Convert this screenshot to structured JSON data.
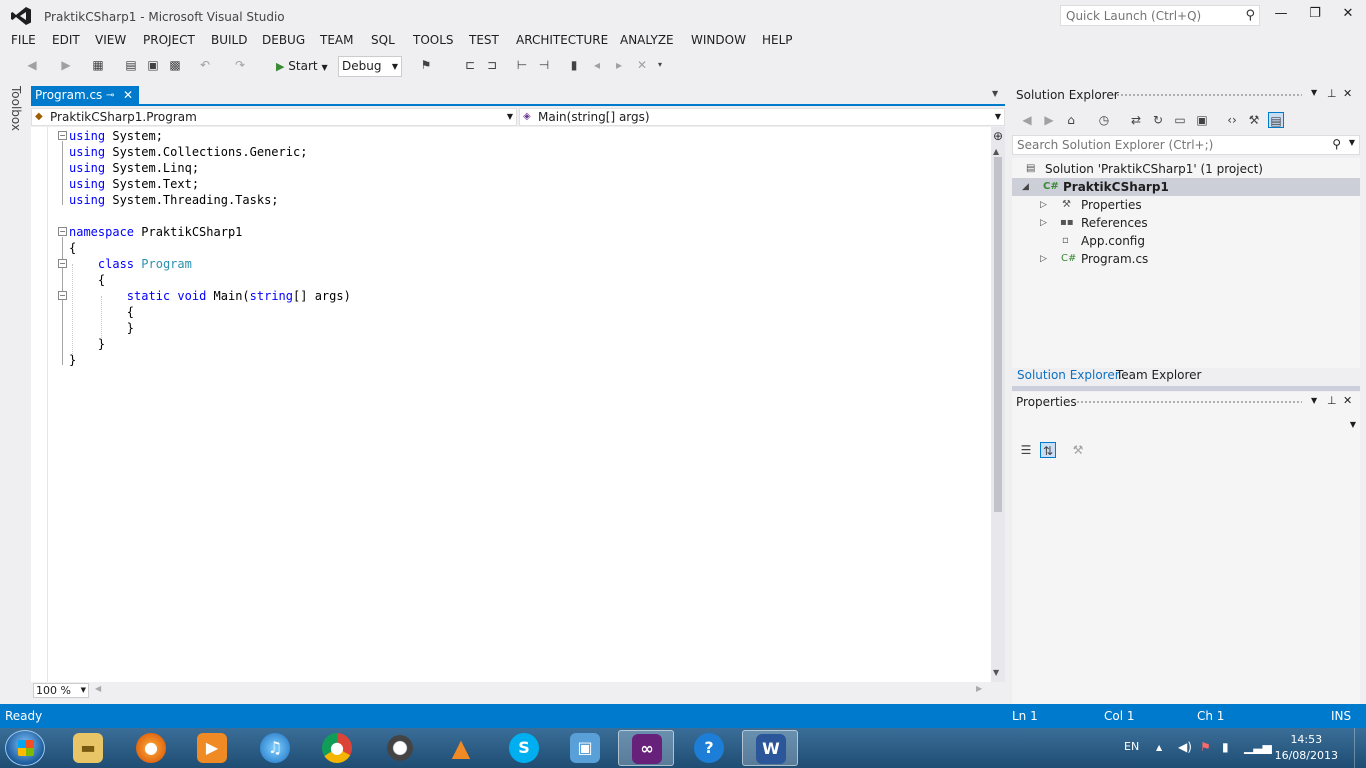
{
  "window": {
    "title": "PraktikCSharp1 - Microsoft Visual Studio",
    "quick_launch_placeholder": "Quick Launch (Ctrl+Q)"
  },
  "menu": [
    "FILE",
    "EDIT",
    "VIEW",
    "PROJECT",
    "BUILD",
    "DEBUG",
    "TEAM",
    "SQL",
    "TOOLS",
    "TEST",
    "ARCHITECTURE",
    "ANALYZE",
    "WINDOW",
    "HELP"
  ],
  "toolbar": {
    "start_label": "Start",
    "configuration": "Debug"
  },
  "toolbox_label": "Toolbox",
  "document": {
    "tab_label": "Program.cs",
    "nav_class": "PraktikCSharp1.Program",
    "nav_member": "Main(string[] args)",
    "zoom": "100 %"
  },
  "code_lines": [
    [
      {
        "t": "kw",
        "s": "using"
      },
      {
        "t": "plain",
        "s": " System;"
      }
    ],
    [
      {
        "t": "kw",
        "s": "using"
      },
      {
        "t": "plain",
        "s": " System.Collections.Generic;"
      }
    ],
    [
      {
        "t": "kw",
        "s": "using"
      },
      {
        "t": "plain",
        "s": " System.Linq;"
      }
    ],
    [
      {
        "t": "kw",
        "s": "using"
      },
      {
        "t": "plain",
        "s": " System.Text;"
      }
    ],
    [
      {
        "t": "kw",
        "s": "using"
      },
      {
        "t": "plain",
        "s": " System.Threading.Tasks;"
      }
    ],
    [],
    [
      {
        "t": "kw",
        "s": "namespace"
      },
      {
        "t": "plain",
        "s": " PraktikCSharp1"
      }
    ],
    [
      {
        "t": "plain",
        "s": "{"
      }
    ],
    [
      {
        "t": "plain",
        "s": "    "
      },
      {
        "t": "kw",
        "s": "class"
      },
      {
        "t": "plain",
        "s": " "
      },
      {
        "t": "ty",
        "s": "Program"
      }
    ],
    [
      {
        "t": "plain",
        "s": "    {"
      }
    ],
    [
      {
        "t": "plain",
        "s": "        "
      },
      {
        "t": "kw",
        "s": "static"
      },
      {
        "t": "plain",
        "s": " "
      },
      {
        "t": "kw",
        "s": "void"
      },
      {
        "t": "plain",
        "s": " Main("
      },
      {
        "t": "kw",
        "s": "string"
      },
      {
        "t": "plain",
        "s": "[] args)"
      }
    ],
    [
      {
        "t": "plain",
        "s": "        {"
      }
    ],
    [
      {
        "t": "plain",
        "s": "        }"
      }
    ],
    [
      {
        "t": "plain",
        "s": "    }"
      }
    ],
    [
      {
        "t": "plain",
        "s": "}"
      }
    ]
  ],
  "solution_explorer": {
    "title": "Solution Explorer",
    "search_placeholder": "Search Solution Explorer (Ctrl+;)",
    "items": [
      {
        "label": "Solution 'PraktikCSharp1' (1 project)",
        "icon": "solution-icon"
      },
      {
        "label": "PraktikCSharp1",
        "icon": "csharp-project-icon"
      },
      {
        "label": "Properties",
        "icon": "wrench-icon"
      },
      {
        "label": "References",
        "icon": "references-icon"
      },
      {
        "label": "App.config",
        "icon": "config-file-icon"
      },
      {
        "label": "Program.cs",
        "icon": "csharp-file-icon"
      }
    ],
    "tabs": [
      "Solution Explorer",
      "Team Explorer"
    ]
  },
  "properties_panel": {
    "title": "Properties"
  },
  "status": {
    "text": "Ready",
    "line": "Ln 1",
    "col": "Col 1",
    "ch": "Ch 1",
    "mode": "INS"
  },
  "taskbar": {
    "language": "EN",
    "time": "14:53",
    "date": "16/08/2013",
    "apps": [
      "explorer",
      "firefox",
      "media-player",
      "itunes",
      "chrome",
      "app-ring",
      "vlc",
      "skype",
      "remote-desktop",
      "visual-studio",
      "help",
      "word"
    ]
  },
  "colors": {
    "accent": "#007acc",
    "keyword": "#0000ff",
    "type": "#2b91af"
  }
}
